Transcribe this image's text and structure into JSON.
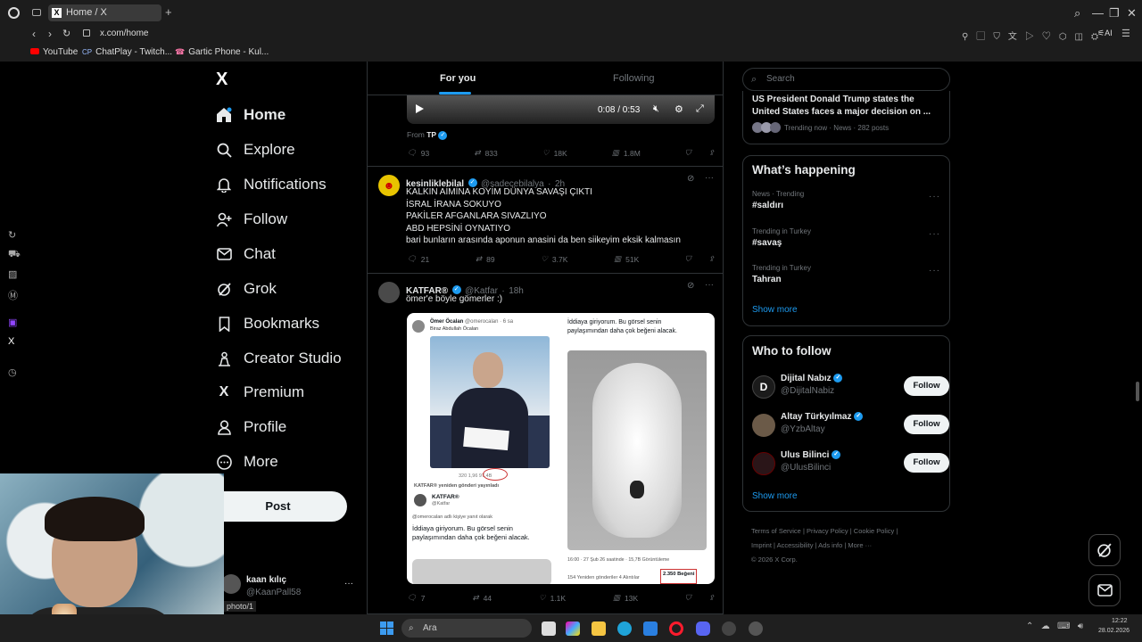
{
  "browser": {
    "tab_title": "Home / X",
    "url": "x.com/home",
    "bookmarks": [
      "YouTube",
      "ChatPlay - Twitch...",
      "Gartic Phone - Kul..."
    ]
  },
  "nav": {
    "logo": "X",
    "items": [
      {
        "label": "Home",
        "icon": "home-icon"
      },
      {
        "label": "Explore",
        "icon": "search-icon"
      },
      {
        "label": "Notifications",
        "icon": "bell-icon"
      },
      {
        "label": "Follow",
        "icon": "add-person-icon"
      },
      {
        "label": "Chat",
        "icon": "mail-icon"
      },
      {
        "label": "Grok",
        "icon": "grok-icon"
      },
      {
        "label": "Bookmarks",
        "icon": "bookmark-icon"
      },
      {
        "label": "Creator Studio",
        "icon": "creator-icon"
      },
      {
        "label": "Premium",
        "icon": "x-icon"
      },
      {
        "label": "Profile",
        "icon": "person-icon"
      },
      {
        "label": "More",
        "icon": "more-circle-icon"
      }
    ],
    "post_label": "Post",
    "account": {
      "name": "kaan kılıç",
      "handle": "@KaanPall58"
    },
    "status_url": "photo/1"
  },
  "feed": {
    "tabs": [
      "For you",
      "Following"
    ],
    "video": {
      "time": "0:08 / 0:53",
      "from": "From",
      "from_name": "TP",
      "actions": {
        "replies": "93",
        "reposts": "833",
        "likes": "18K",
        "views": "1.8M"
      }
    },
    "tweets": [
      {
        "name": "kesinliklebilal",
        "handle": "@sadecebilalya",
        "time": "2h",
        "lines": [
          "KALKIN AİMİNA KOYİM DÜNYA SAVAŞI ÇIKTI",
          "İSRAL İRANA SOKUYO",
          "PAKİLER AFGANLARA SIVAZLIYO",
          "ABD HEPSİNİ OYNATIYO",
          "bari bunların arasında aponun anasini da ben siikeyim eksik kalmasın"
        ],
        "actions": {
          "replies": "21",
          "reposts": "89",
          "likes": "3.7K",
          "views": "51K"
        }
      },
      {
        "name": "KATFAR®",
        "handle": "@Katfar",
        "time": "18h",
        "text": "ömer'e böyle gömerler :)",
        "media": {
          "left_name": "Ömer Öcalan",
          "left_handle": "@omerocalan · 6 sa",
          "left_sub": "Biraz Abdullah Öcalan",
          "left_counts": "320   1,96   97.4B",
          "reposted": "KATFAR® yeniden gönderi yayınladı",
          "q_name": "KATFAR®",
          "q_handle": "@Katfar",
          "q_reply": "@omerocalan adlı kişiye yanıt olarak",
          "q_text": "İddiaya giriyorum. Bu görsel senin paylaşımından daha çok beğeni alacak.",
          "right_text": "İddiaya giriyorum. Bu görsel senin paylaşımından daha çok beğeni alacak.",
          "right_date": "16:00 · 27 Şub 26 saatinde · 15,7B Görüntüleme",
          "right_stats": "154 Yeniden gönderiler   4 Alıntılar",
          "right_likes": "2.350 Beğeni"
        },
        "actions": {
          "replies": "7",
          "reposts": "44",
          "likes": "1.1K",
          "views": "13K"
        }
      }
    ]
  },
  "right": {
    "search_placeholder": "Search",
    "top_story": {
      "text": "US President Donald Trump states the United States faces a major decision on ...",
      "meta": "Trending now · News · 282 posts"
    },
    "happening": {
      "title": "What’s happening",
      "items": [
        {
          "context": "News · Trending",
          "tag": "#saldırı"
        },
        {
          "context": "Trending in Turkey",
          "tag": "#savaş"
        },
        {
          "context": "Trending in Turkey",
          "tag": "Tahran"
        }
      ],
      "show_more": "Show more"
    },
    "who": {
      "title": "Who to follow",
      "items": [
        {
          "name": "Dijital Nabız",
          "handle": "@DijitalNabiz",
          "btn": "Follow"
        },
        {
          "name": "Altay Türkyılmaz",
          "handle": "@YzbAltay",
          "btn": "Follow"
        },
        {
          "name": "Ulus Bilinci",
          "handle": "@UlusBilinci",
          "btn": "Follow"
        }
      ],
      "show_more": "Show more"
    },
    "footer": {
      "line1": [
        "Terms of Service",
        "Privacy Policy",
        "Cookie Policy"
      ],
      "line2": [
        "Imprint",
        "Accessibility",
        "Ads info",
        "More ···"
      ],
      "copy": "© 2026 X Corp."
    }
  },
  "taskbar": {
    "search": "Ara",
    "time": "12:22",
    "date": "28.02.2026"
  },
  "colors": {
    "accent": "#1d9bf0",
    "background": "#000000",
    "border": "#2f3336"
  }
}
